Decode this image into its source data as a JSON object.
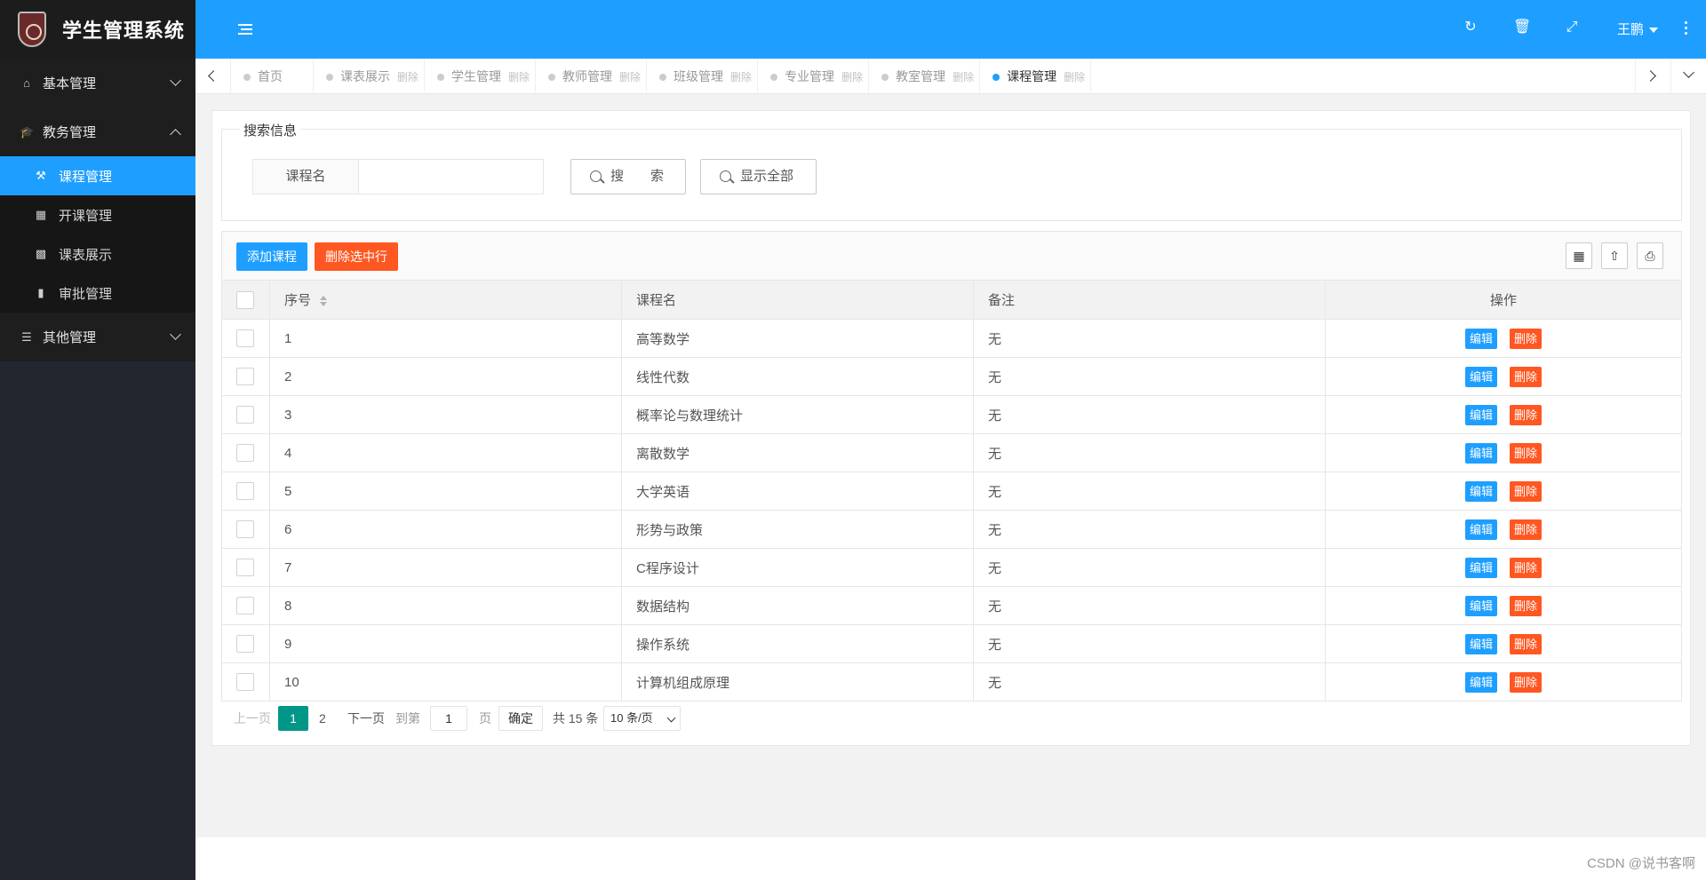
{
  "app": {
    "title": "学生管理系统"
  },
  "sidebar": {
    "groups": [
      {
        "label": "基本管理",
        "icon": "home-icon",
        "expanded": false
      },
      {
        "label": "教务管理",
        "icon": "graduation-cap-icon",
        "expanded": true,
        "items": [
          {
            "label": "课程管理",
            "icon": "gavel-icon",
            "active": true
          },
          {
            "label": "开课管理",
            "icon": "calendar-icon",
            "active": false
          },
          {
            "label": "课表展示",
            "icon": "table-icon",
            "active": false
          },
          {
            "label": "审批管理",
            "icon": "book-icon",
            "active": false
          }
        ]
      },
      {
        "label": "其他管理",
        "icon": "list-icon",
        "expanded": false
      }
    ]
  },
  "header": {
    "icons": [
      "refresh-icon",
      "trash-icon",
      "fullscreen-icon"
    ],
    "user": "王鹏"
  },
  "tabs": [
    {
      "label": "首页",
      "close": "",
      "active": false
    },
    {
      "label": "课表展示",
      "close": "删除",
      "active": false
    },
    {
      "label": "学生管理",
      "close": "删除",
      "active": false
    },
    {
      "label": "教师管理",
      "close": "删除",
      "active": false
    },
    {
      "label": "班级管理",
      "close": "删除",
      "active": false
    },
    {
      "label": "专业管理",
      "close": "删除",
      "active": false
    },
    {
      "label": "教室管理",
      "close": "删除",
      "active": false
    },
    {
      "label": "课程管理",
      "close": "删除",
      "active": true
    }
  ],
  "search": {
    "legend": "搜索信息",
    "field_label": "课程名",
    "value": "",
    "placeholder": "",
    "search_button": "搜　　索",
    "show_all_button": "显示全部"
  },
  "toolbar": {
    "add_button": "添加课程",
    "delete_selected_button": "删除选中行",
    "icons": [
      "columns-icon",
      "export-icon",
      "print-icon"
    ]
  },
  "table": {
    "columns": [
      "序号",
      "课程名",
      "备注",
      "操作"
    ],
    "edit_label": "编辑",
    "delete_label": "删除",
    "rows": [
      {
        "no": "1",
        "name": "高等数学",
        "remark": "无"
      },
      {
        "no": "2",
        "name": "线性代数",
        "remark": "无"
      },
      {
        "no": "3",
        "name": "概率论与数理统计",
        "remark": "无"
      },
      {
        "no": "4",
        "name": "离散数学",
        "remark": "无"
      },
      {
        "no": "5",
        "name": "大学英语",
        "remark": "无"
      },
      {
        "no": "6",
        "name": "形势与政策",
        "remark": "无"
      },
      {
        "no": "7",
        "name": "C程序设计",
        "remark": "无"
      },
      {
        "no": "8",
        "name": "数据结构",
        "remark": "无"
      },
      {
        "no": "9",
        "name": "操作系统",
        "remark": "无"
      },
      {
        "no": "10",
        "name": "计算机组成原理",
        "remark": "无"
      }
    ]
  },
  "pager": {
    "prev": "上一页",
    "pages": [
      "1",
      "2"
    ],
    "current": "1",
    "next": "下一页",
    "goto_label": "到第",
    "goto_value": "1",
    "page_unit": "页",
    "confirm": "确定",
    "total": "共 15 条",
    "page_size": "10 条/页"
  },
  "watermark": "CSDN @说书客啊"
}
